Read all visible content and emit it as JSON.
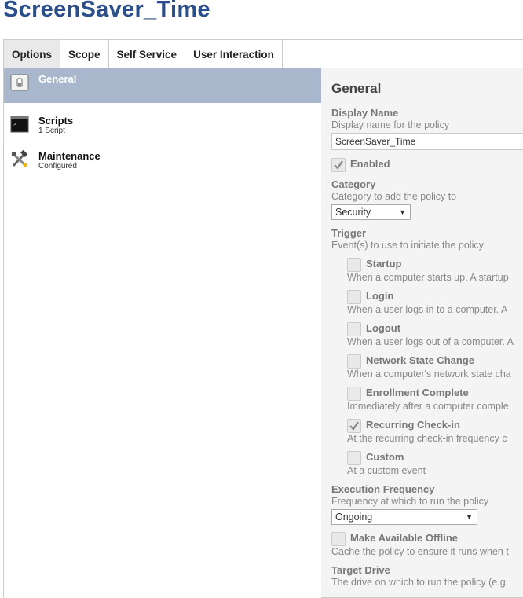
{
  "page": {
    "title": "ScreenSaver_Time"
  },
  "tabs": [
    {
      "label": "Options"
    },
    {
      "label": "Scope"
    },
    {
      "label": "Self Service"
    },
    {
      "label": "User Interaction"
    }
  ],
  "sidebar": {
    "items": [
      {
        "label": "General",
        "sub": ""
      },
      {
        "label": "Scripts",
        "sub": "1 Script"
      },
      {
        "label": "Maintenance",
        "sub": "Configured"
      }
    ]
  },
  "general": {
    "title": "General",
    "display_name": {
      "label": "Display Name",
      "desc": "Display name for the policy",
      "value": "ScreenSaver_Time"
    },
    "enabled": {
      "label": "Enabled",
      "checked": true
    },
    "category": {
      "label": "Category",
      "desc": "Category to add the policy to",
      "value": "Security"
    },
    "trigger": {
      "label": "Trigger",
      "desc": "Event(s) to use to initiate the policy",
      "options": [
        {
          "label": "Startup",
          "desc": "When a computer starts up. A startup",
          "checked": false
        },
        {
          "label": "Login",
          "desc": "When a user logs in to a computer. A",
          "checked": false
        },
        {
          "label": "Logout",
          "desc": "When a user logs out of a computer. A",
          "checked": false
        },
        {
          "label": "Network State Change",
          "desc": "When a computer's network state cha",
          "checked": false
        },
        {
          "label": "Enrollment Complete",
          "desc": "Immediately after a computer comple",
          "checked": false
        },
        {
          "label": "Recurring Check-in",
          "desc": "At the recurring check-in frequency c",
          "checked": true
        },
        {
          "label": "Custom",
          "desc": "At a custom event",
          "checked": false
        }
      ]
    },
    "execution_frequency": {
      "label": "Execution Frequency",
      "desc": "Frequency at which to run the policy",
      "value": "Ongoing"
    },
    "offline": {
      "label": "Make Available Offline",
      "desc": "Cache the policy to ensure it runs when t",
      "checked": false
    },
    "target_drive": {
      "label": "Target Drive",
      "desc": "The drive on which to run the policy (e.g."
    }
  },
  "colors": {
    "title_blue": "#2b4f8b",
    "active_nav": "#a9b7cd",
    "panel_bg": "#f4f4f4"
  },
  "icons": {
    "general": "switch-icon",
    "scripts": "terminal-icon",
    "maintenance": "tools-icon",
    "check": "checkmark-icon",
    "dropdown": "triangle-down-icon"
  }
}
